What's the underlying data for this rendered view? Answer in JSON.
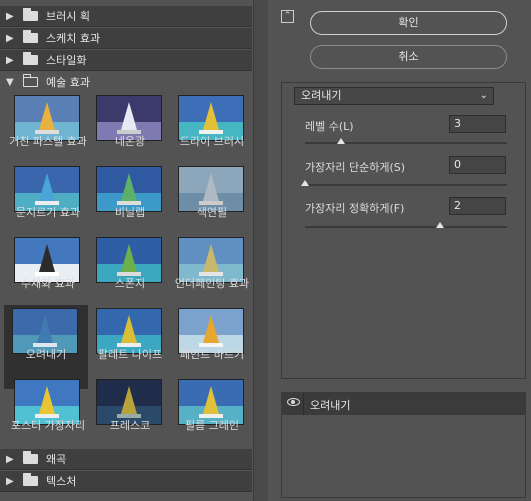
{
  "filter_gallery": {
    "categories_top": [
      {
        "label": "브러시 획",
        "expanded": false
      },
      {
        "label": "스케치 효과",
        "expanded": false
      },
      {
        "label": "스타일화",
        "expanded": false
      },
      {
        "label": "예술 효과",
        "expanded": true
      }
    ],
    "artistic_filters": [
      {
        "label": "거친 파스텔 효과"
      },
      {
        "label": "네온광"
      },
      {
        "label": "드라이 브러시"
      },
      {
        "label": "문지르기 효과"
      },
      {
        "label": "비닐랩"
      },
      {
        "label": "색연필"
      },
      {
        "label": "수채화 효과"
      },
      {
        "label": "스폰지"
      },
      {
        "label": "언더페인팅 효과"
      },
      {
        "label": "오려내기",
        "selected": true
      },
      {
        "label": "팔레트 나이프"
      },
      {
        "label": "페인트 바르기"
      },
      {
        "label": "포스터 가장자리"
      },
      {
        "label": "프레스코"
      },
      {
        "label": "필름 그레인"
      }
    ],
    "categories_bottom": [
      {
        "label": "왜곡",
        "expanded": false
      },
      {
        "label": "텍스처",
        "expanded": false
      }
    ]
  },
  "dialog": {
    "ok_label": "확인",
    "cancel_label": "취소",
    "filter_select": "오려내기",
    "params": [
      {
        "label": "레벨 수(L)",
        "value": "3",
        "fraction": 0.18
      },
      {
        "label": "가장자리 단순하게(S)",
        "value": "0",
        "fraction": 0.0
      },
      {
        "label": "가장자리 정확하게(F)",
        "value": "2",
        "fraction": 0.67
      }
    ],
    "layer_name": "오려내기"
  },
  "colors": {
    "background": "#535353",
    "category_bar": "#3f3f3f",
    "selected_thumb": "#303030",
    "input_bg": "#454545"
  }
}
